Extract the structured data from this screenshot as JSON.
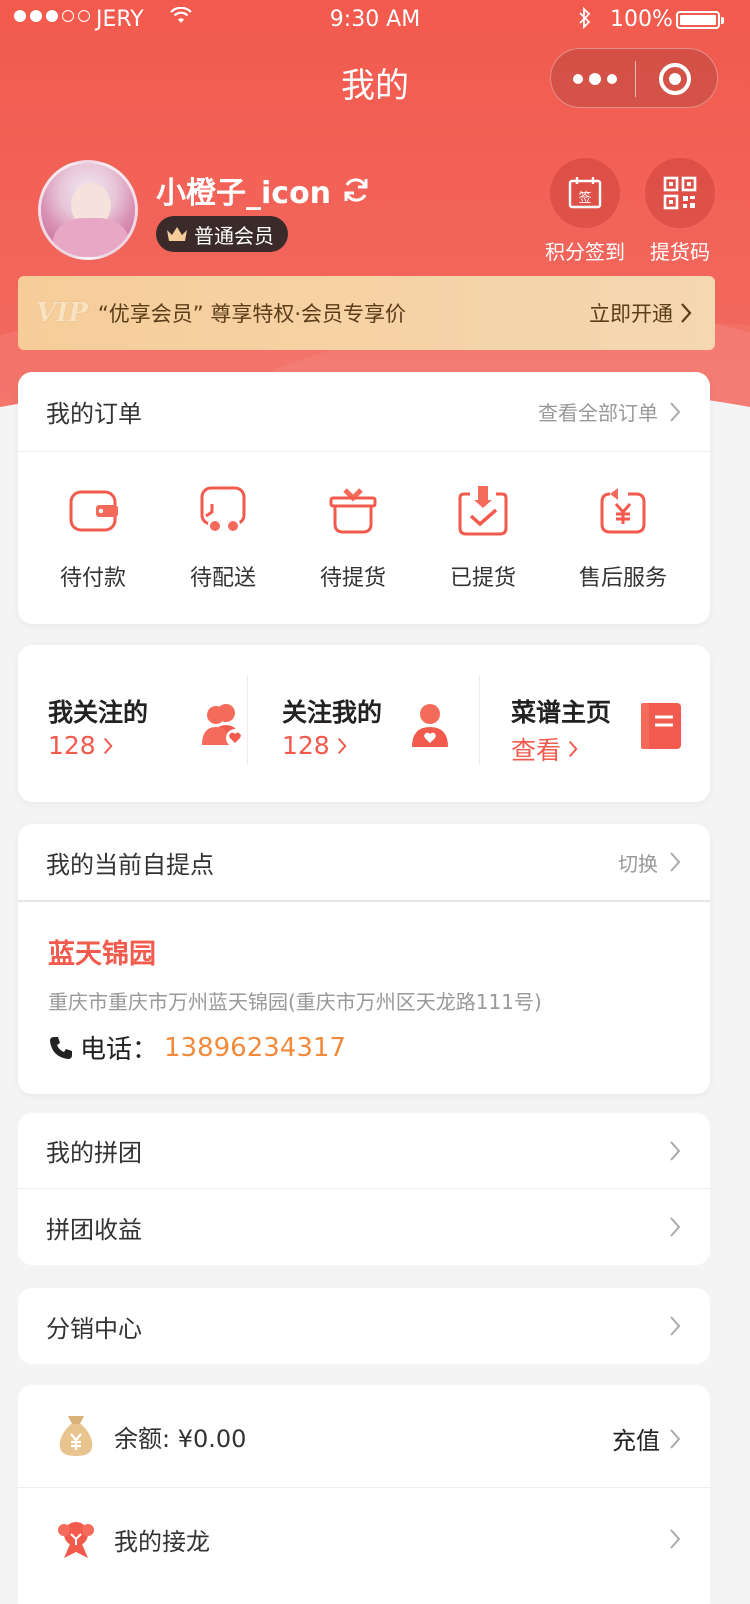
{
  "status_bar": {
    "carrier": "JERY",
    "time": "9:30 AM",
    "battery": "100%"
  },
  "nav": {
    "title": "我的"
  },
  "profile": {
    "username": "小橙子_icon",
    "level_badge": "普通会员"
  },
  "quick_actions": [
    {
      "label": "积分签到",
      "icon": "sign-in-calendar-icon"
    },
    {
      "label": "提货码",
      "icon": "qr-code-icon"
    }
  ],
  "vip_banner": {
    "logo": "VIP",
    "text": "“优享会员” 尊享特权·会员专享价",
    "cta": "立即开通"
  },
  "orders": {
    "title": "我的订单",
    "view_all": "查看全部订单",
    "items": [
      {
        "label": "待付款",
        "icon": "wallet-icon"
      },
      {
        "label": "待配送",
        "icon": "delivery-truck-icon"
      },
      {
        "label": "待提货",
        "icon": "gift-box-icon"
      },
      {
        "label": "已提货",
        "icon": "received-check-icon"
      },
      {
        "label": "售后服务",
        "icon": "refund-yen-icon"
      }
    ]
  },
  "social": [
    {
      "title": "我关注的",
      "value": "128",
      "icon": "following-users-icon"
    },
    {
      "title": "关注我的",
      "value": "128",
      "icon": "follower-user-icon"
    },
    {
      "title": "菜谱主页",
      "value": "查看",
      "icon": "recipe-book-icon"
    }
  ],
  "pickup": {
    "title": "我的当前自提点",
    "switch": "切换",
    "store_name": "蓝天锦园",
    "address": "重庆市重庆市万州蓝天锦园(重庆市万州区天龙路111号)",
    "phone_label": "电话：",
    "phone": "13896234317"
  },
  "menu_group": [
    {
      "label": "我的拼团"
    },
    {
      "label": "拼团收益"
    }
  ],
  "distribution": {
    "label": "分销中心"
  },
  "wallet": {
    "balance_label": "余额: ¥0.00",
    "recharge": "充值",
    "relay_label": "我的接龙"
  },
  "colors": {
    "primary": "#f25a4d",
    "accent_orange": "#f28a3c",
    "vip_gold": "#f6cd99"
  }
}
